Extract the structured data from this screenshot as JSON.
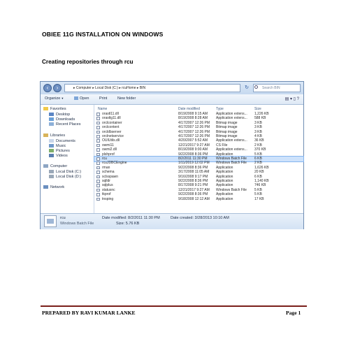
{
  "document": {
    "title": "OBIEE 11G INSTALLATION ON WINDOWS",
    "subtitle": "Creating repositories through rcu",
    "footer_left": "PREPARED BY RAVI KUMAR LANKE",
    "footer_right": "Page 1",
    "footer_rule_color": "#7a1f1a"
  },
  "explorer": {
    "address_path": "▸ Computer ▸ Local Disk (C:) ▸ rcuHome ▸ BIN",
    "search_placeholder": "Search BIN",
    "toolbar": {
      "organize": "Organize",
      "open": "Open",
      "print": "Print",
      "new_folder": "New folder"
    },
    "nav": {
      "favorites": "Favorites",
      "desktop": "Desktop",
      "downloads": "Downloads",
      "recent_places": "Recent Places",
      "libraries": "Libraries",
      "documents": "Documents",
      "music": "Music",
      "pictures": "Pictures",
      "videos": "Videos",
      "computer": "Computer",
      "local_disk_c": "Local Disk (C:)",
      "local_disk_d": "Local Disk (D:)",
      "network": "Network"
    },
    "columns": {
      "name": "Name",
      "date_modified": "Date modified",
      "type": "Type",
      "size": "Size"
    },
    "files": [
      {
        "name": "orastl11.dll",
        "date": "8/19/2008 9:15 AM",
        "type": "Application extens...",
        "size": "1,226 KB"
      },
      {
        "name": "orastlg11.dll",
        "date": "8/19/2008 8:28 AM",
        "type": "Application extens...",
        "size": "588 KB"
      },
      {
        "name": "orclcontainer",
        "date": "4/17/2007 12:26 PM",
        "type": "Bitmap image",
        "size": "3 KB"
      },
      {
        "name": "orclcontent",
        "date": "4/17/2007 12:26 PM",
        "type": "Bitmap image",
        "size": "3 KB"
      },
      {
        "name": "orcldbserver",
        "date": "4/17/2007 12:26 PM",
        "type": "Bitmap image",
        "size": "3 KB"
      },
      {
        "name": "orclnetservice",
        "date": "4/17/2007 12:26 PM",
        "type": "Bitmap image",
        "size": "4 KB"
      },
      {
        "name": "OUIUtils.dll",
        "date": "4/20/2007 5:52 AM",
        "type": "Application extens...",
        "size": "36 KB"
      },
      {
        "name": "owmi11",
        "date": "12/21/2017 9:27 AM",
        "type": "CS File",
        "size": "2 KB"
      },
      {
        "name": "owmi2.dll",
        "date": "8/19/2008 9:00 AM",
        "type": "Application extens...",
        "size": "370 KB"
      },
      {
        "name": "plshprof",
        "date": "9/22/2008 8:36 PM",
        "type": "Application",
        "size": "5 KB"
      },
      {
        "name": "rcu",
        "date": "8/2/2011 11:30 PM",
        "type": "Windows Batch File",
        "size": "6 KB",
        "selected": true
      },
      {
        "name": "rcuJDBCEngine",
        "date": "1/11/2019 12:02 PM",
        "type": "Windows Batch File",
        "size": "2 KB"
      },
      {
        "name": "rman",
        "date": "9/22/2008 8:36 PM",
        "type": "Application",
        "size": "1,626 KB"
      },
      {
        "name": "schema",
        "date": "3/17/2008 11:05 AM",
        "type": "Application",
        "size": "20 KB"
      },
      {
        "name": "sclsspawn",
        "date": "9/16/2008 9:17 PM",
        "type": "Application",
        "size": "6 KB"
      },
      {
        "name": "sqlldr",
        "date": "9/22/2008 8:36 PM",
        "type": "Application",
        "size": "1,140 KB"
      },
      {
        "name": "sqlplus",
        "date": "8/17/2008 9:21 PM",
        "type": "Application",
        "size": "746 KB"
      },
      {
        "name": "statusnc",
        "date": "12/21/2017 9:27 AM",
        "type": "Windows Batch File",
        "size": "5 KB"
      },
      {
        "name": "tkprof",
        "date": "9/22/2008 8:36 PM",
        "type": "Application",
        "size": "5 KB"
      },
      {
        "name": "tnsping",
        "date": "9/18/2008 12:12 AM",
        "type": "Application",
        "size": "17 KB"
      }
    ],
    "details": {
      "name": "rcu",
      "type": "Windows Batch File",
      "date_modified": "Date modified: 8/2/2011 11:30 PM",
      "size": "Size: 5.76 KB",
      "date_created": "Date created: 3/28/2013 10:10 AM"
    }
  }
}
